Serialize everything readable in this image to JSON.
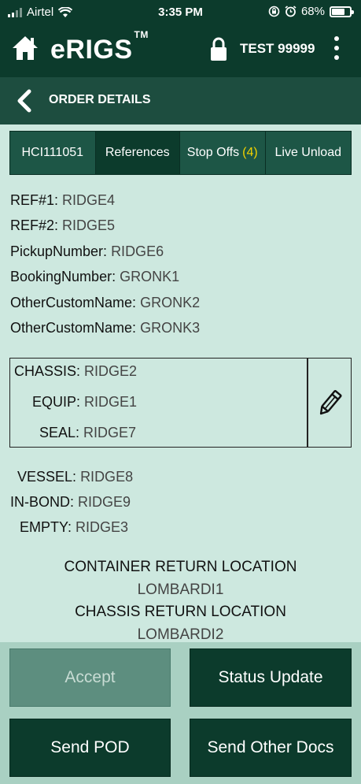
{
  "status_bar": {
    "carrier": "Airtel",
    "time": "3:35 PM",
    "battery": "68%"
  },
  "app_bar": {
    "title": "eRIGS",
    "trademark": "TM",
    "user": "TEST 99999"
  },
  "sub_header": {
    "title": "ORDER DETAILS"
  },
  "tabs": [
    {
      "label": "HCI111051",
      "count": ""
    },
    {
      "label": "References",
      "count": ""
    },
    {
      "label": "Stop Offs",
      "count": "(4)"
    },
    {
      "label": "Live Unload",
      "count": ""
    }
  ],
  "references": [
    {
      "label": "REF#1:",
      "value": "RIDGE4"
    },
    {
      "label": "REF#2:",
      "value": "RIDGE5"
    },
    {
      "label": "PickupNumber:",
      "value": "RIDGE6"
    },
    {
      "label": "BookingNumber:",
      "value": "GRONK1"
    },
    {
      "label": "OtherCustomName:",
      "value": "GRONK2"
    },
    {
      "label": "OtherCustomName:",
      "value": "GRONK3"
    }
  ],
  "equipment_box": [
    {
      "label": "CHASSIS:",
      "value": "RIDGE2"
    },
    {
      "label": "EQUIP:",
      "value": "RIDGE1"
    },
    {
      "label": "SEAL:",
      "value": "RIDGE7"
    }
  ],
  "other_refs": [
    {
      "label": "VESSEL:",
      "value": "RIDGE8"
    },
    {
      "label": "IN-BOND:",
      "value": "RIDGE9"
    },
    {
      "label": "EMPTY:",
      "value": "RIDGE3"
    }
  ],
  "container_return": {
    "label": "CONTAINER RETURN LOCATION",
    "value": "LOMBARDI1"
  },
  "chassis_return": {
    "label": "CHASSIS RETURN LOCATION",
    "value": "LOMBARDI2"
  },
  "buttons": {
    "accept": "Accept",
    "status_update": "Status Update",
    "send_pod": "Send POD",
    "send_other_docs": "Send Other Docs"
  },
  "colors": {
    "header": "#0c3b2c",
    "sub_header": "#1d4d3f",
    "background": "#cde8df",
    "tab_count": "#f1d100"
  },
  "icons": [
    "signal-icon",
    "wifi-icon",
    "orientation-lock-icon",
    "alarm-icon",
    "battery-icon",
    "home-icon",
    "lock-icon",
    "more-vert-icon",
    "back-chevron-icon",
    "pencil-icon"
  ]
}
